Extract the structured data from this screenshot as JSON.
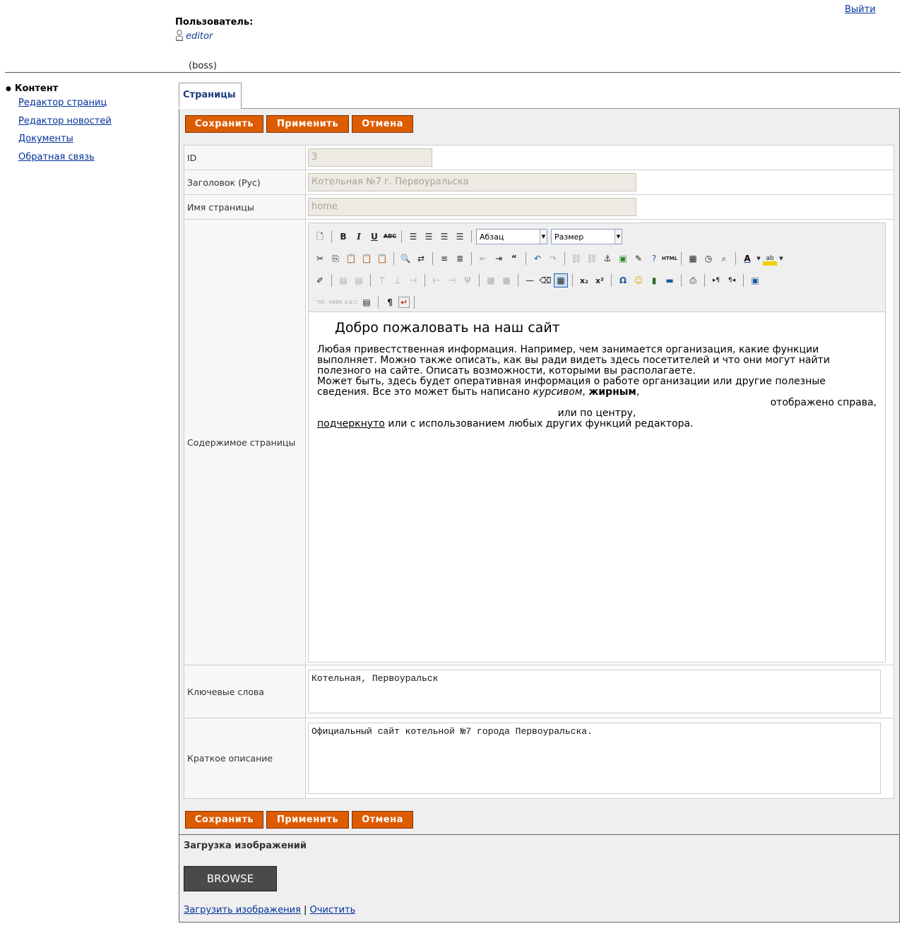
{
  "header": {
    "logout": "Выйти",
    "user_label": "Пользователь:",
    "user_name": "editor",
    "user_role": "(boss)"
  },
  "sidebar": {
    "heading": "Контент",
    "items": [
      {
        "label": "Редактор страниц"
      },
      {
        "label": "Редактор новостей"
      },
      {
        "label": "Документы"
      },
      {
        "label": "Обратная связь"
      }
    ]
  },
  "tab": {
    "label": "Страницы"
  },
  "buttons": {
    "save": "Сохранить",
    "apply": "Применить",
    "cancel": "Отмена"
  },
  "form": {
    "id": {
      "label": "ID",
      "value": "3"
    },
    "title": {
      "label": "Заголовок (Рус)",
      "value": "Котельная №7 г. Первоуральска"
    },
    "page_name": {
      "label": "Имя страницы",
      "value": "home"
    },
    "content": {
      "label": "Содержимое страницы"
    },
    "keywords": {
      "label": "Ключевые слова",
      "value": "Котельная, Первоуральск"
    },
    "description": {
      "label": "Краткое описание",
      "value": "Официальный сайт котельной №7 города Первоуральска."
    }
  },
  "editor": {
    "format_select": "Абзац",
    "size_select": "Размер",
    "heading": "Добро пожаловать на наш сайт",
    "para1": "Любая привестственная информация. Например, чем занимается организация, какие функции выполняет. Можно также описать, как вы ради видеть здесь посетителей и что они могут найти полезного на сайте. Описать возможности, которыми вы располагаете.",
    "para2_start": "Может быть, здесь будет оперативная информация о работе организации или другие полезные сведения. Все это может быть написано ",
    "italic": "курсивом",
    "comma": ", ",
    "bold": "жирным",
    "comma2": ",",
    "right_line": "отображено справа,",
    "center_line": "или по центру,",
    "underline": "подчеркнуто",
    "last": " или с использованием любых других функций редактора."
  },
  "upload": {
    "title": "Загрузка изображений",
    "browse": "BROWSE",
    "upload_link": "Загрузить изображения",
    "separator": "|",
    "clear_link": "Очистить"
  },
  "colors": {
    "button": "#dd5c00",
    "link": "#00329b",
    "panel": "#efefef"
  }
}
